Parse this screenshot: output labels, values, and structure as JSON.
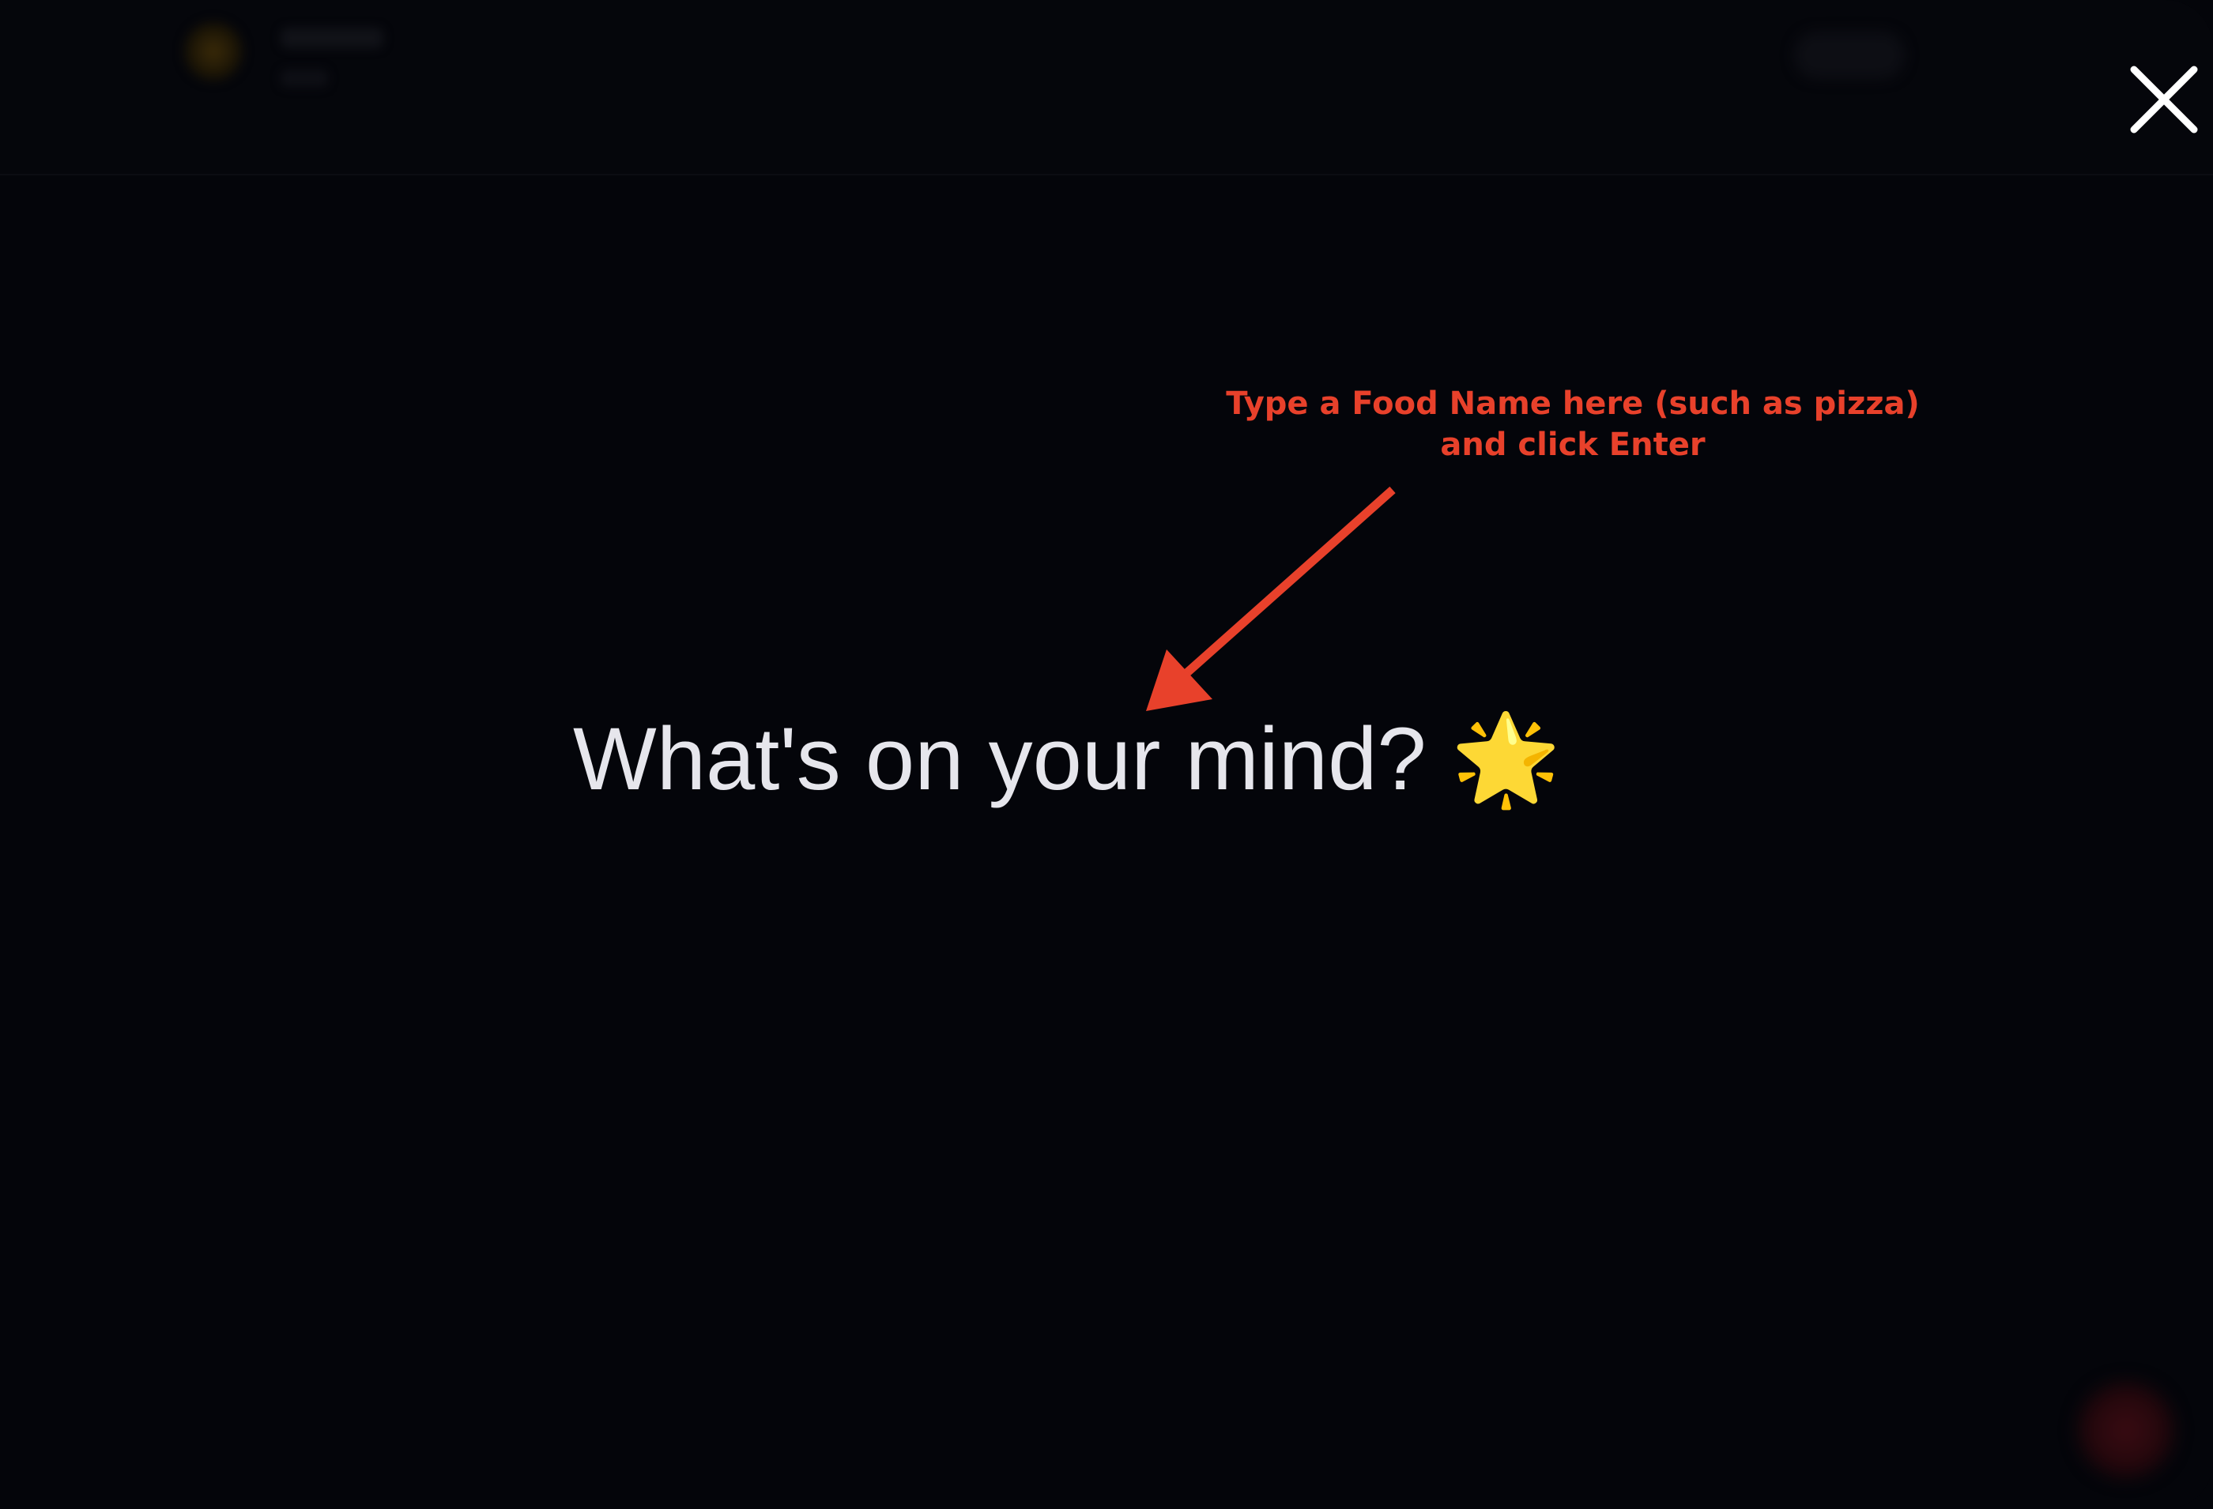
{
  "prompt": {
    "placeholder": "What's on your mind? 🌟",
    "value": ""
  },
  "annotation": {
    "line1": "Type a Food Name here (such as pizza)",
    "line2": "and click Enter",
    "color": "#e8412b"
  },
  "icons": {
    "close": "close-icon",
    "arrow": "arrow-icon"
  },
  "colors": {
    "background": "#04050a",
    "prompt_text": "#e6e6ec",
    "close_icon": "#ffffff"
  }
}
